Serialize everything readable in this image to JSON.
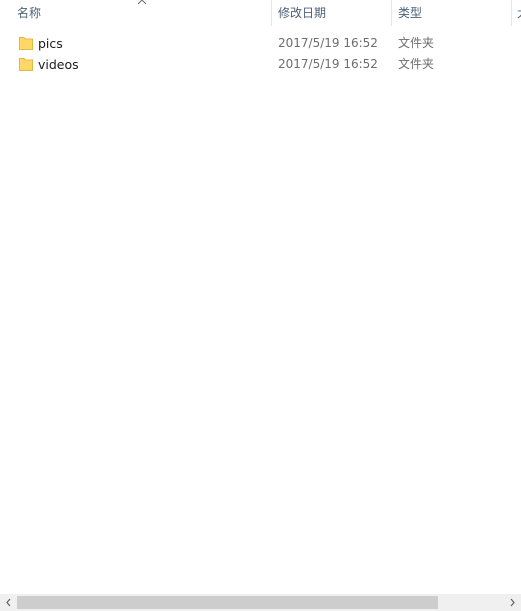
{
  "columns": {
    "name": "名称",
    "modified": "修改日期",
    "type": "类型",
    "size_partial": "大"
  },
  "sort": {
    "column": "name",
    "direction": "ascending",
    "icon": "chevron-up-icon"
  },
  "files": [
    {
      "name": "pics",
      "modified": "2017/5/19 16:52",
      "type": "文件夹",
      "icon": "folder-icon"
    },
    {
      "name": "videos",
      "modified": "2017/5/19 16:52",
      "type": "文件夹",
      "icon": "folder-icon"
    }
  ],
  "colors": {
    "header_text": "#4c607a",
    "folder_fill": "#ffd766",
    "folder_edge": "#e0b84a",
    "scrollbar_track": "#f0f0f0",
    "scrollbar_thumb": "#cdcdcd"
  }
}
